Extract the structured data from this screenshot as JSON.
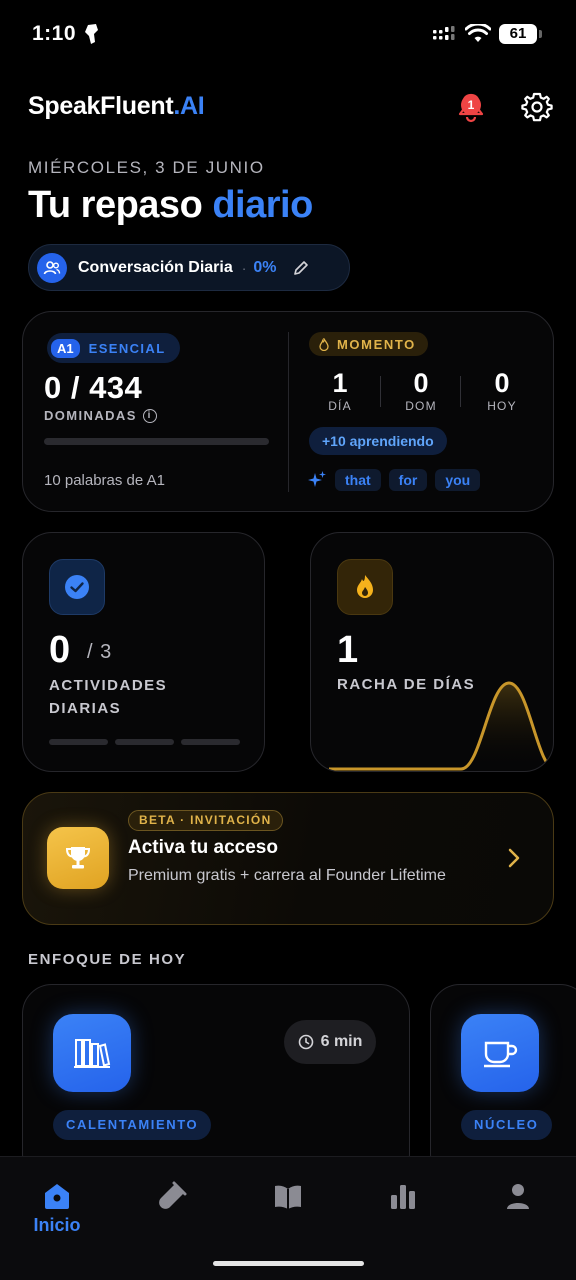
{
  "status_bar": {
    "time": "1:10",
    "battery": "61"
  },
  "header": {
    "brand_main": "SpeakFluent",
    "brand_suffix": ".AI",
    "notification_count": "1"
  },
  "hero": {
    "date": "MIÉRCOLES, 3 DE JUNIO",
    "title_main": "Tu repaso ",
    "title_accent": "diario"
  },
  "mode_pill": {
    "label": "Conversación Diaria",
    "separator": "·",
    "progress": "0%"
  },
  "stats_card": {
    "level_badge": "A1",
    "level_label": "ESENCIAL",
    "count": "0 / 434",
    "count_label": "DOMINADAS",
    "progress_fraction": 0,
    "note": "10 palabras de A1",
    "momentum_label": "MOMENTO",
    "stats": [
      {
        "value": "1",
        "label": "DÍA"
      },
      {
        "value": "0",
        "label": "DOM"
      },
      {
        "value": "0",
        "label": "HOY"
      }
    ],
    "learning_chip": "+10 aprendiendo",
    "word_chips": [
      "that",
      "for",
      "you"
    ]
  },
  "activities_tile": {
    "value": "0",
    "total": "/ 3",
    "label": "ACTIVIDADES DIARIAS",
    "segments_done": 0,
    "segments_total": 3
  },
  "streak_tile": {
    "value": "1",
    "label": "RACHA DE DÍAS"
  },
  "promo": {
    "badge": "BETA · INVITACIÓN",
    "title": "Activa tu acceso",
    "subtitle": "Premium gratis + carrera al Founder Lifetime"
  },
  "focus": {
    "heading": "ENFOQUE DE HOY",
    "cards": [
      {
        "tag": "CALENTAMIENTO",
        "duration": "6 min",
        "icon": "books-icon"
      },
      {
        "tag": "NÚCLEO",
        "icon": "cup-icon"
      }
    ]
  },
  "bottom_nav": {
    "items": [
      {
        "label": "Inicio",
        "icon": "home-icon",
        "active": true
      },
      {
        "icon": "flask-icon"
      },
      {
        "icon": "book-icon"
      },
      {
        "icon": "chart-icon"
      },
      {
        "icon": "profile-icon"
      }
    ]
  },
  "colors": {
    "accent": "#3b82f6",
    "gold": "#e0b34a",
    "background": "#000000"
  }
}
